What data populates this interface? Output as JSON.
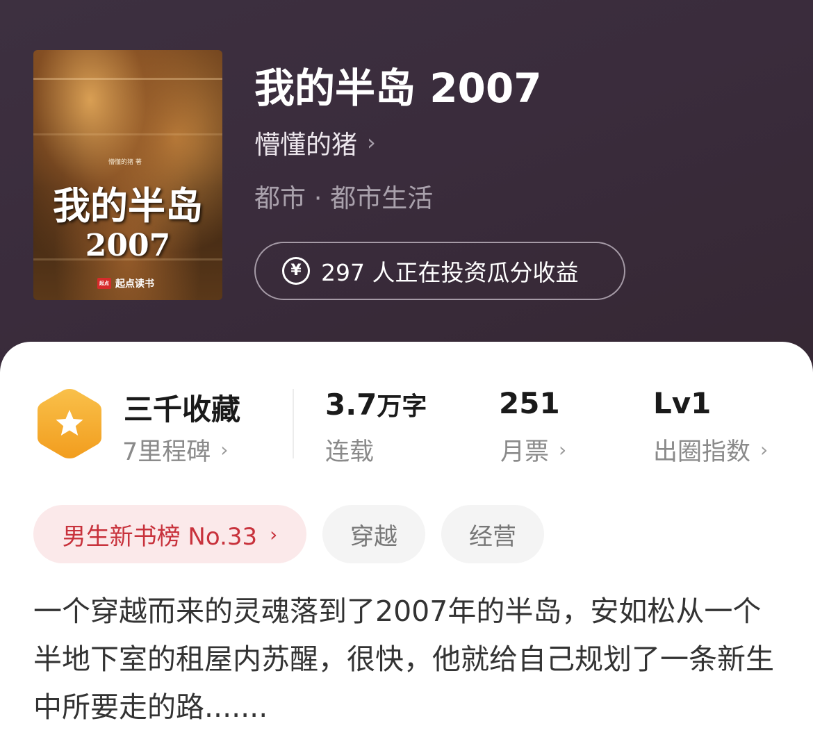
{
  "book": {
    "title": "我的半岛 2007",
    "author": "懵懂的猪",
    "genre": "都市 · 都市生活",
    "invest_text": "297 人正在投资瓜分收益"
  },
  "cover": {
    "author_line": "懵懂的猪 著",
    "title": "我的半岛",
    "year": "2007",
    "brand_logo": "起点",
    "brand": "起点读书"
  },
  "stats": [
    {
      "main": "三千收藏",
      "sub": "7里程碑"
    },
    {
      "main": "3.7",
      "unit": "万字",
      "sub": "连载"
    },
    {
      "main": "251",
      "sub": "月票"
    },
    {
      "main": "Lv1",
      "sub": "出圈指数"
    }
  ],
  "tags": {
    "rank": "男生新书榜 No.33",
    "items": [
      "穿越",
      "经营"
    ]
  },
  "description": "一个穿越而来的灵魂落到了2007年的半岛，安如松从一个半地下室的租屋内苏醒，很快，他就给自己规划了一条新生中所要走的路.......",
  "icons": {
    "chevron": "›",
    "yen": "¥",
    "milestone": "star-hexagon-icon"
  },
  "colors": {
    "header_bg": "#3a2c3c",
    "badge_gold": "#f5a623",
    "rank_red": "#c8323c",
    "rank_bg": "#fbe9ea"
  }
}
